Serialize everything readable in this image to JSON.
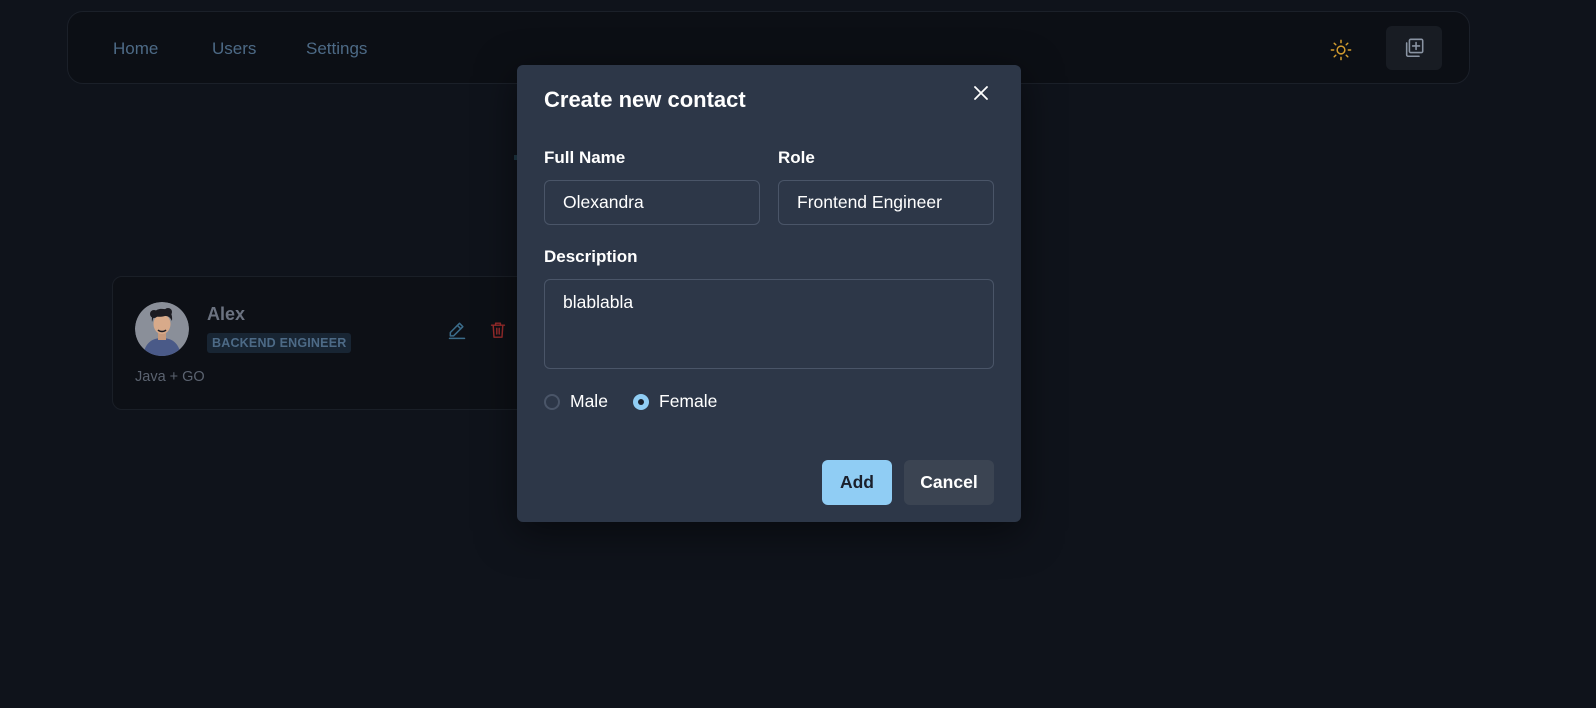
{
  "colors": {
    "background": "#0f131b",
    "modal_background": "#2d3748",
    "accent": "#90cdf4",
    "nav_link": "#4d6a86",
    "theme_icon": "#d69e2e",
    "delete_icon": "#9b2c2c"
  },
  "navbar": {
    "links": [
      {
        "label": "Home"
      },
      {
        "label": "Users"
      },
      {
        "label": "Settings"
      }
    ],
    "theme_toggle_icon": "sun-icon",
    "add_contact_icon": "add-copy-icon"
  },
  "contact_card": {
    "name": "Alex",
    "role": "BACKEND ENGINEER",
    "description": "Java + GO",
    "avatar_icon": "user-avatar",
    "edit_icon": "pencil-icon",
    "delete_icon": "trash-icon"
  },
  "modal": {
    "title": "Create new contact",
    "close_icon": "close-icon",
    "full_name": {
      "label": "Full Name",
      "value": "Olexandra"
    },
    "role": {
      "label": "Role",
      "value": "Frontend Engineer"
    },
    "description": {
      "label": "Description",
      "value": "blablabla"
    },
    "gender": {
      "options": [
        {
          "label": "Male",
          "checked": false
        },
        {
          "label": "Female",
          "checked": true
        }
      ]
    },
    "add_label": "Add",
    "cancel_label": "Cancel"
  }
}
